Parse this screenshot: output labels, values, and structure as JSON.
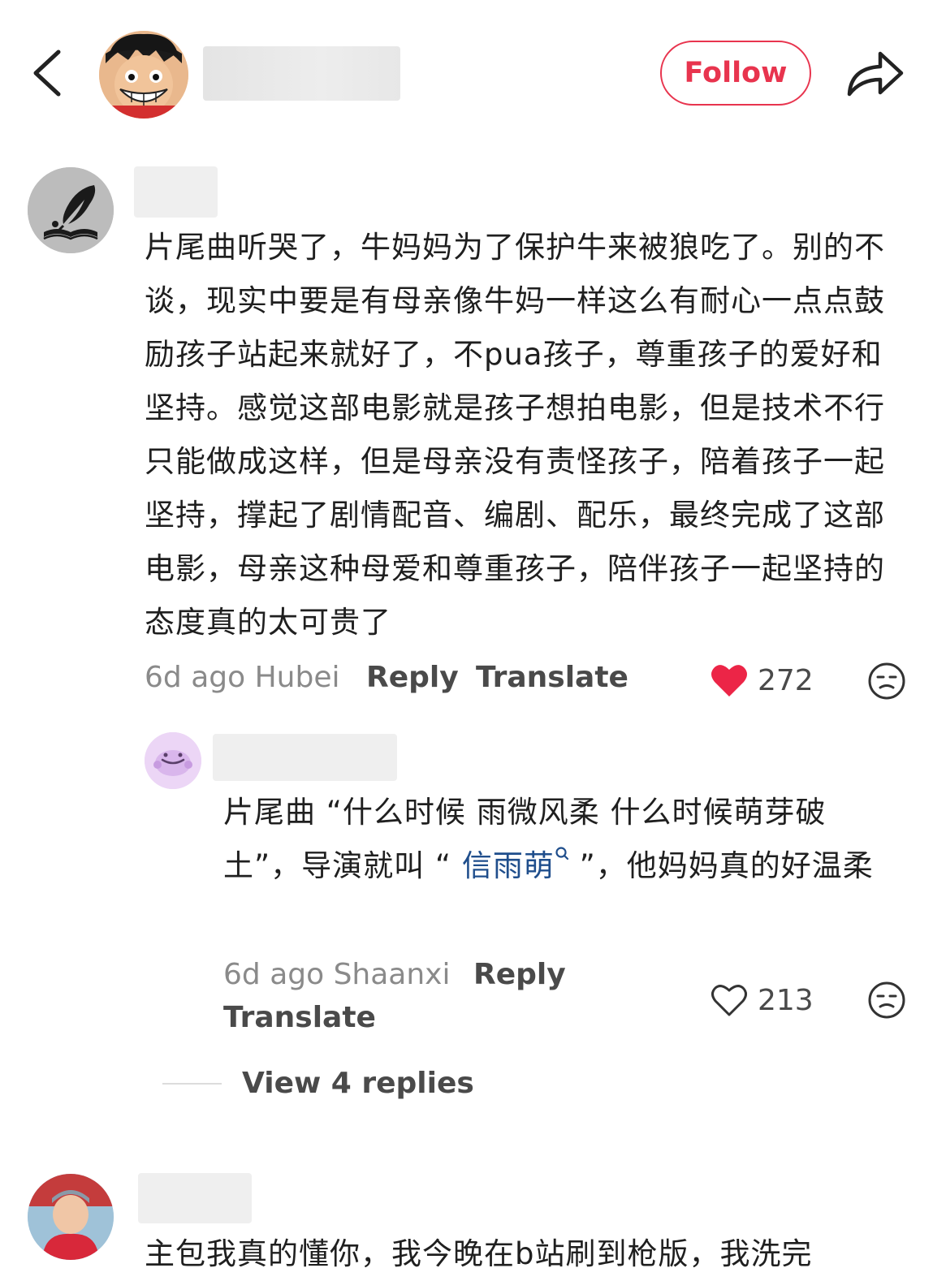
{
  "header": {
    "follow_label": "Follow"
  },
  "comments": [
    {
      "text": "片尾曲听哭了，牛妈妈为了保护牛来被狼吃了。别的不谈，现实中要是有母亲像牛妈一样这么有耐心一点点鼓励孩子站起来就好了，不pua孩子，尊重孩子的爱好和坚持。感觉这部电影就是孩子想拍电影，但是技术不行只能做成这样，但是母亲没有责怪孩子，陪着孩子一起坚持，撑起了剧情配音、编剧、配乐，最终完成了这部电影，母亲这种母爱和尊重孩子，陪伴孩子一起坚持的态度真的太可贵了",
      "time_location": "6d ago Hubei",
      "reply_label": "Reply",
      "translate_label": "Translate",
      "likes": "272",
      "liked": true,
      "reply": {
        "text_before": "片尾曲 “什么时候 雨微风柔 什么时候萌芽破土”，导演就叫 “ ",
        "mention": "信雨萌",
        "text_after": " ”，他妈妈真的好温柔",
        "time_location": "6d ago Shaanxi",
        "reply_label": "Reply",
        "translate_label": "Translate",
        "likes": "213",
        "liked": false
      },
      "view_replies_label": "View 4 replies"
    },
    {
      "text": "主包我真的懂你，我今晚在b站刷到枪版，我洗完"
    }
  ],
  "colors": {
    "accent": "#e8344e",
    "mention": "#1f4e8c",
    "meta": "#8a8a8a"
  }
}
